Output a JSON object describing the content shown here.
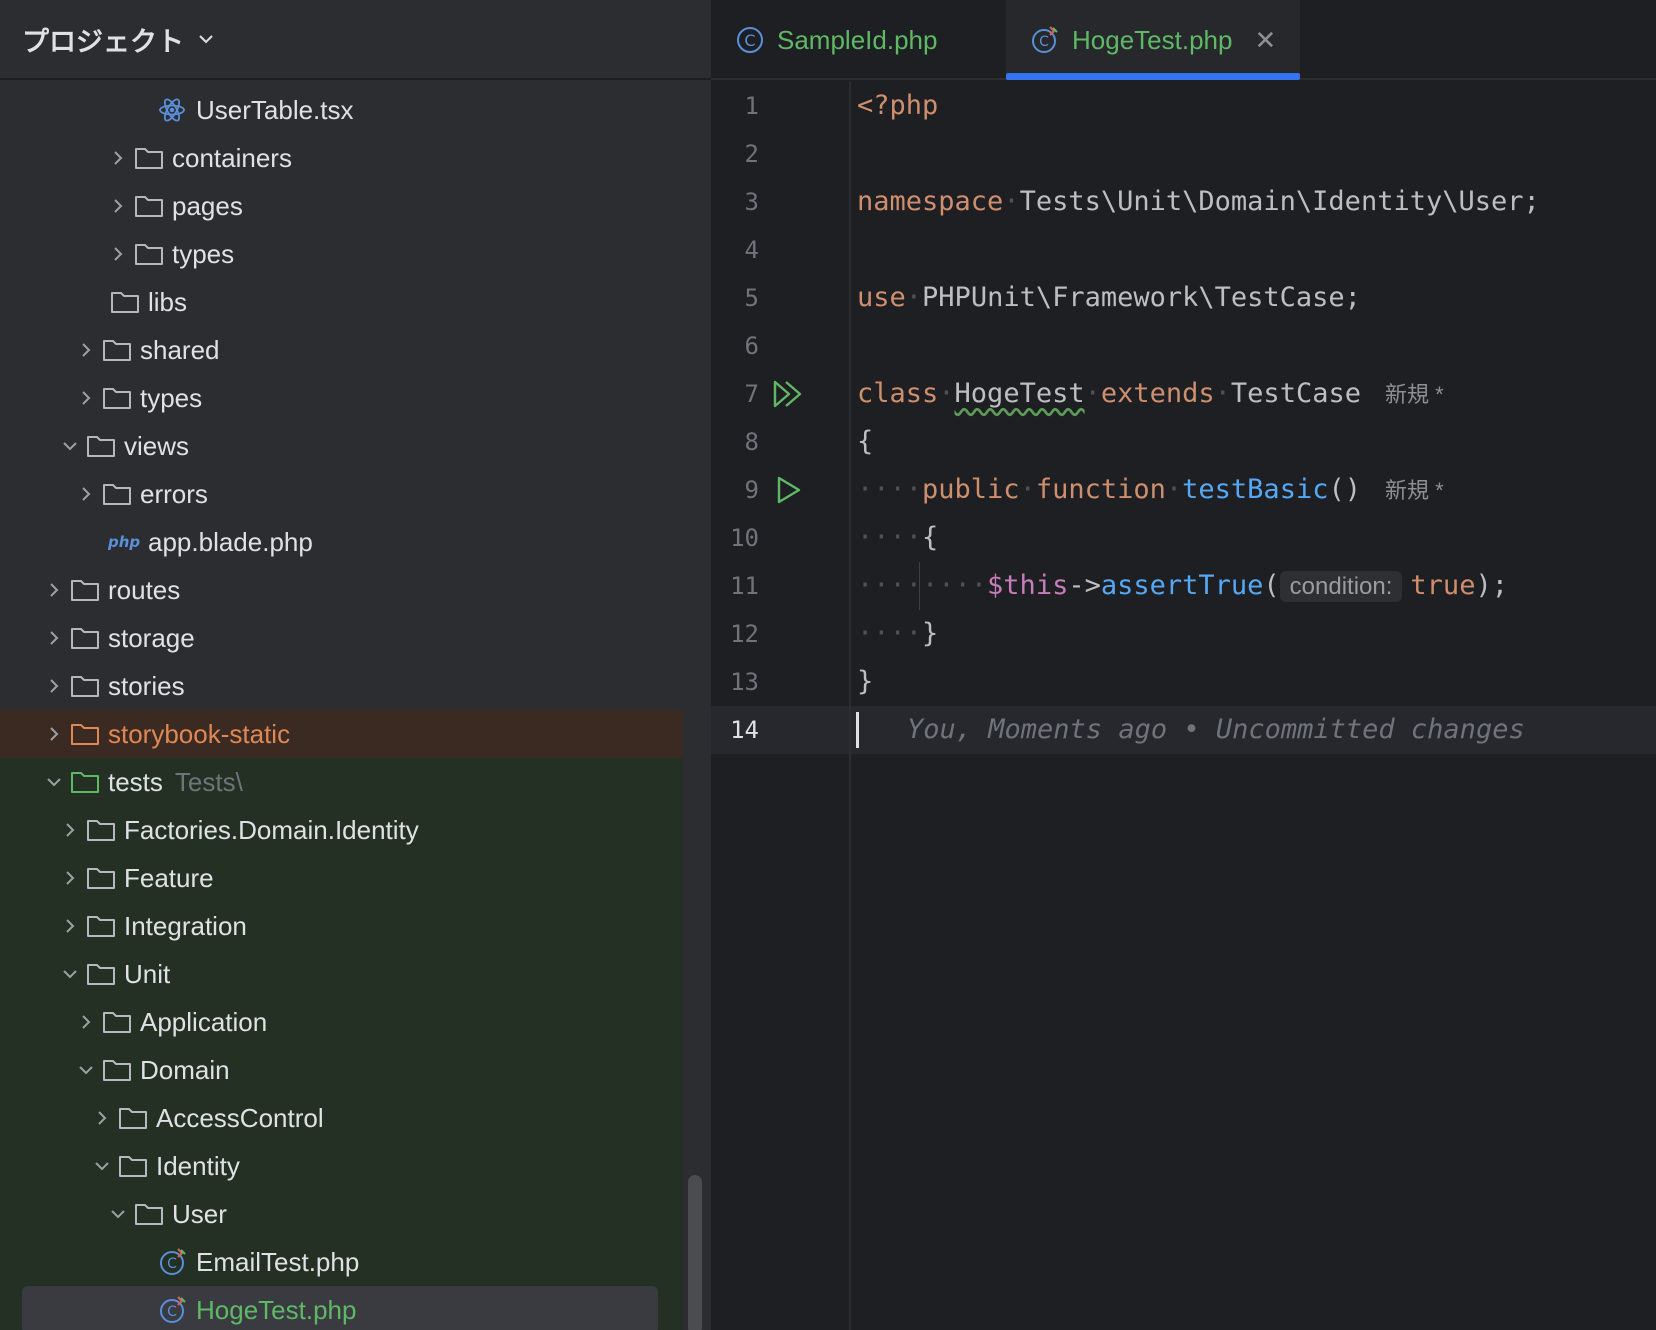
{
  "sidebar": {
    "title": "プロジェクト",
    "rows": [
      {
        "label": "UserTable.tsx",
        "hint": ""
      },
      {
        "label": "containers",
        "hint": ""
      },
      {
        "label": "pages",
        "hint": ""
      },
      {
        "label": "types",
        "hint": ""
      },
      {
        "label": "libs",
        "hint": ""
      },
      {
        "label": "shared",
        "hint": ""
      },
      {
        "label": "types",
        "hint": ""
      },
      {
        "label": "views",
        "hint": ""
      },
      {
        "label": "errors",
        "hint": ""
      },
      {
        "label": "app.blade.php",
        "hint": ""
      },
      {
        "label": "routes",
        "hint": ""
      },
      {
        "label": "storage",
        "hint": ""
      },
      {
        "label": "stories",
        "hint": ""
      },
      {
        "label": "storybook-static",
        "hint": ""
      },
      {
        "label": "tests",
        "hint": "Tests\\"
      },
      {
        "label": "Factories.Domain.Identity",
        "hint": ""
      },
      {
        "label": "Feature",
        "hint": ""
      },
      {
        "label": "Integration",
        "hint": ""
      },
      {
        "label": "Unit",
        "hint": ""
      },
      {
        "label": "Application",
        "hint": ""
      },
      {
        "label": "Domain",
        "hint": ""
      },
      {
        "label": "AccessControl",
        "hint": ""
      },
      {
        "label": "Identity",
        "hint": ""
      },
      {
        "label": "User",
        "hint": ""
      },
      {
        "label": "EmailTest.php",
        "hint": ""
      },
      {
        "label": "HogeTest.php",
        "hint": ""
      }
    ]
  },
  "tabs": [
    {
      "label": "SampleId.php",
      "active": false
    },
    {
      "label": "HogeTest.php",
      "active": true
    }
  ],
  "editor": {
    "line_numbers": [
      "1",
      "2",
      "3",
      "4",
      "5",
      "6",
      "7",
      "8",
      "9",
      "10",
      "11",
      "12",
      "13",
      "14"
    ],
    "current_line": "14",
    "line1": "<?php",
    "line3_kw": "namespace",
    "line3_rest": "Tests\\Unit\\Domain\\Identity\\User;",
    "line5_kw": "use",
    "line5_rest": "PHPUnit\\Framework\\TestCase;",
    "line7_kw1": "class",
    "line7_cls": "HogeTest",
    "line7_kw2": "extends",
    "line7_parent": "TestCase",
    "line7_hint": "新規 *",
    "line8": "{",
    "line9_dots": "····",
    "line9_kw1": "public",
    "line9_kw2": "function",
    "line9_fn": "testBasic",
    "line9_paren": "()",
    "line9_hint": "新規 *",
    "line10_dots": "····",
    "line10": "{",
    "line11_dots": "········",
    "line11_var": "$this",
    "line11_arrow": "->",
    "line11_fn": "assertTrue",
    "line11_open": "(",
    "line11_param": "condition:",
    "line11_val": "true",
    "line11_close": ");",
    "line12_dots": "····",
    "line12": "}",
    "line13": "}",
    "blame": "You, Moments ago • Uncommitted changes"
  },
  "colors": {
    "accent": "#3574f0",
    "keyword": "#cf8e6d",
    "function": "#56a8f5",
    "added": "#5fb865",
    "ignored": "#e08855"
  }
}
